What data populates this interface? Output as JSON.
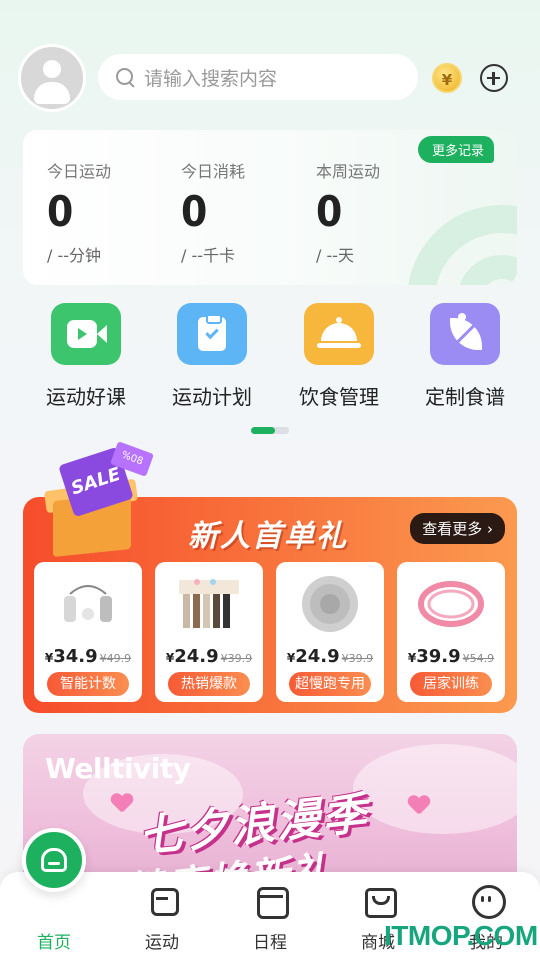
{
  "header": {
    "search_placeholder": "请输入搜索内容",
    "coin_symbol": "¥"
  },
  "stats": {
    "more_records": "更多记录",
    "items": [
      {
        "label": "今日运动",
        "value": "0",
        "unit": "/ --分钟"
      },
      {
        "label": "今日消耗",
        "value": "0",
        "unit": "/ --千卡"
      },
      {
        "label": "本周运动",
        "value": "0",
        "unit": "/ --天"
      }
    ]
  },
  "quick_links": [
    {
      "label": "运动好课",
      "icon": "video-play-icon",
      "color": "#3dc56d"
    },
    {
      "label": "运动计划",
      "icon": "clipboard-check-icon",
      "color": "#5db5f5"
    },
    {
      "label": "饮食管理",
      "icon": "food-cloche-icon",
      "color": "#f6b73c"
    },
    {
      "label": "定制食谱",
      "icon": "leaf-icon",
      "color": "#9b8cf4"
    }
  ],
  "promo": {
    "title": "新人首单礼",
    "more": "查看更多 ›",
    "sale_tag": "SALE",
    "sale_small": "%08",
    "products": [
      {
        "price": "34.9",
        "old": "¥49.9",
        "tag": "智能计数"
      },
      {
        "price": "24.9",
        "old": "¥39.9",
        "tag": "热销爆款"
      },
      {
        "price": "24.9",
        "old": "¥39.9",
        "tag": "超慢跑专用"
      },
      {
        "price": "39.9",
        "old": "¥54.9",
        "tag": "居家训练"
      }
    ]
  },
  "banner": {
    "brand": "Welltivity",
    "title": "七夕浪漫季",
    "subtitle": "健康焕新礼"
  },
  "tabbar": {
    "items": [
      {
        "label": "首页",
        "icon": "home-icon"
      },
      {
        "label": "运动",
        "icon": "dumbbell-icon"
      },
      {
        "label": "日程",
        "icon": "calendar-icon"
      },
      {
        "label": "商城",
        "icon": "shopping-bag-icon"
      },
      {
        "label": "我的",
        "icon": "face-icon"
      }
    ]
  },
  "watermark": "ITMOP.COM",
  "colors": {
    "accent": "#1db15f",
    "promo": "#f64d2b"
  }
}
